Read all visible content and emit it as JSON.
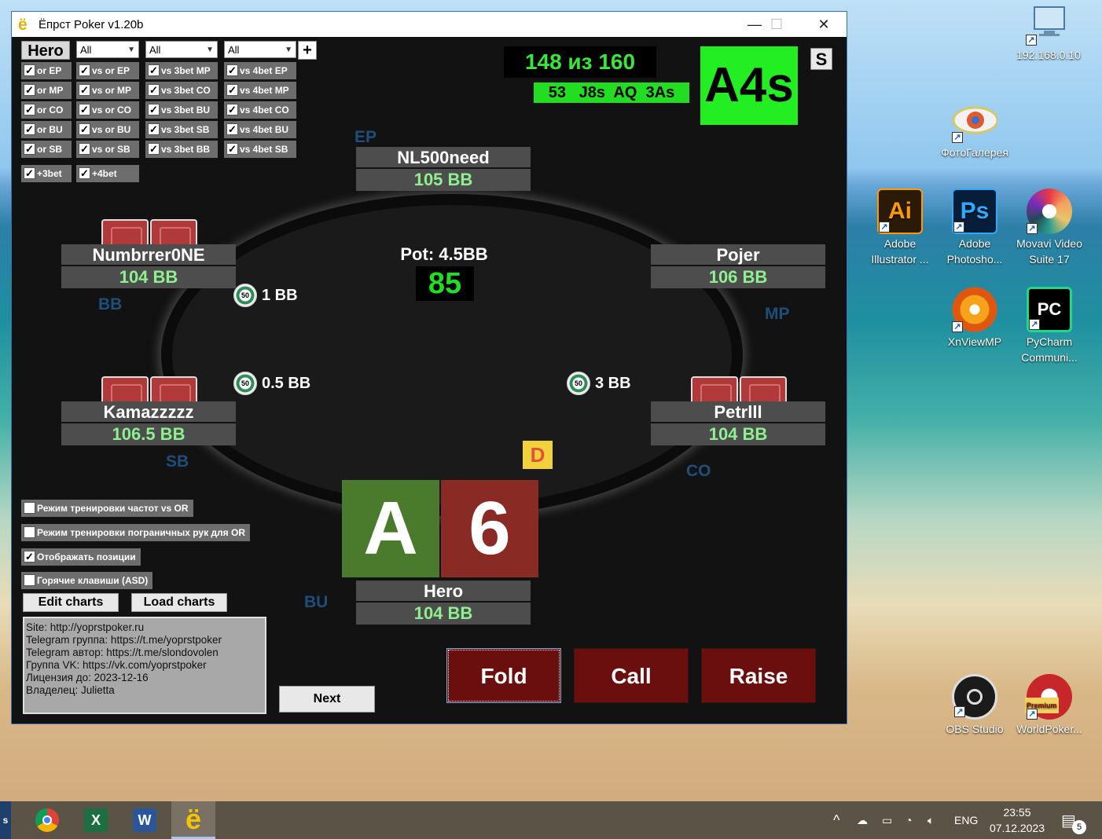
{
  "window": {
    "title": "Ёпрст Poker v1.20b",
    "icon_char": "ё",
    "minimize": "—",
    "maximize": "☐",
    "close": "✕"
  },
  "filters": {
    "hero_label": "Hero",
    "selects": [
      "All",
      "All",
      "All"
    ],
    "add_label": "+",
    "col1": [
      "or EP",
      "or MP",
      "or CO",
      "or BU",
      "or SB"
    ],
    "col2": [
      "vs or EP",
      "vs or MP",
      "vs or CO",
      "vs or BU",
      "vs or SB"
    ],
    "col3": [
      "vs 3bet MP",
      "vs 3bet CO",
      "vs 3bet BU",
      "vs 3bet SB",
      "vs 3bet BB"
    ],
    "col4": [
      "vs 4bet EP",
      "vs 4bet MP",
      "vs 4bet CO",
      "vs 4bet BU",
      "vs 4bet SB"
    ],
    "extra": [
      "+3bet",
      "+4bet"
    ],
    "checkmark": "✓"
  },
  "progress": {
    "counter": "148 из 160",
    "errors": "53   J8s  AQ  3As",
    "current_hand": "A4s",
    "s_label": "S"
  },
  "players": {
    "ep": {
      "name": "NL500need",
      "stack": "105 BB",
      "position": "EP"
    },
    "bb": {
      "name": "Numbrrer0NE",
      "stack": "104 BB",
      "position": "BB"
    },
    "mp": {
      "name": "Pojer",
      "stack": "106 BB",
      "position": "MP"
    },
    "sb": {
      "name": "Kamazzzzz",
      "stack": "106.5 BB",
      "position": "SB"
    },
    "co": {
      "name": "Petrlll",
      "stack": "104 BB",
      "position": "CO"
    },
    "hero": {
      "name": "Hero",
      "stack": "104 BB",
      "position": "BU"
    }
  },
  "pot": {
    "label": "Pot: 4.5BB",
    "timer": "85"
  },
  "bets": {
    "bb": "1 BB",
    "sb": "0.5 BB",
    "co": "3 BB",
    "chip_label": "50"
  },
  "dealer": "D",
  "hero_cards": {
    "card1": "A",
    "card2": "6",
    "card1_color": "#4a7a2c",
    "card2_color": "#8a2a24"
  },
  "actions": {
    "fold": "Fold",
    "call": "Call",
    "raise": "Raise"
  },
  "options": [
    {
      "label": "Режим тренировки частот vs OR",
      "checked": ""
    },
    {
      "label": "Режим тренировки пограничных рук для OR",
      "checked": ""
    },
    {
      "label": "Отображать позиции",
      "checked": "✓"
    },
    {
      "label": "Горячие клавиши (ASD)",
      "checked": ""
    }
  ],
  "buttons": {
    "edit_charts": "Edit charts",
    "load_charts": "Load charts",
    "next": "Next"
  },
  "info_lines": [
    "Site: http://yoprstpoker.ru",
    "Telegram группа: https://t.me/yoprstpoker",
    "Telegram автор: https://t.me/slondovolen",
    "Группа VK: https://vk.com/yoprstpoker",
    "Лицензия до: 2023-12-16",
    "Владелец: Julietta"
  ],
  "desktop": {
    "icons": [
      {
        "label": "192.168.0.10"
      },
      {
        "label": "ФотоГалерея"
      },
      {
        "label": "Adobe Illustrator ..."
      },
      {
        "label": "Adobe Photosho..."
      },
      {
        "label": "Movavi Video Suite 17"
      },
      {
        "label": "XnViewMP"
      },
      {
        "label": "PyCharm Communi..."
      },
      {
        "label": "OBS Studio"
      },
      {
        "label": "WorldPoker..."
      }
    ],
    "icon_glyphs": {
      "ai": "Ai",
      "ps": "Ps",
      "pc": "PC",
      "premium": "Premium"
    }
  },
  "taskbar": {
    "lang": "ENG",
    "time": "23:55",
    "date": "07.12.2023",
    "notifications": "5",
    "tray_up": "^",
    "app_chars": {
      "excel": "X",
      "word": "W",
      "yo": "ё",
      "left": "s"
    }
  }
}
